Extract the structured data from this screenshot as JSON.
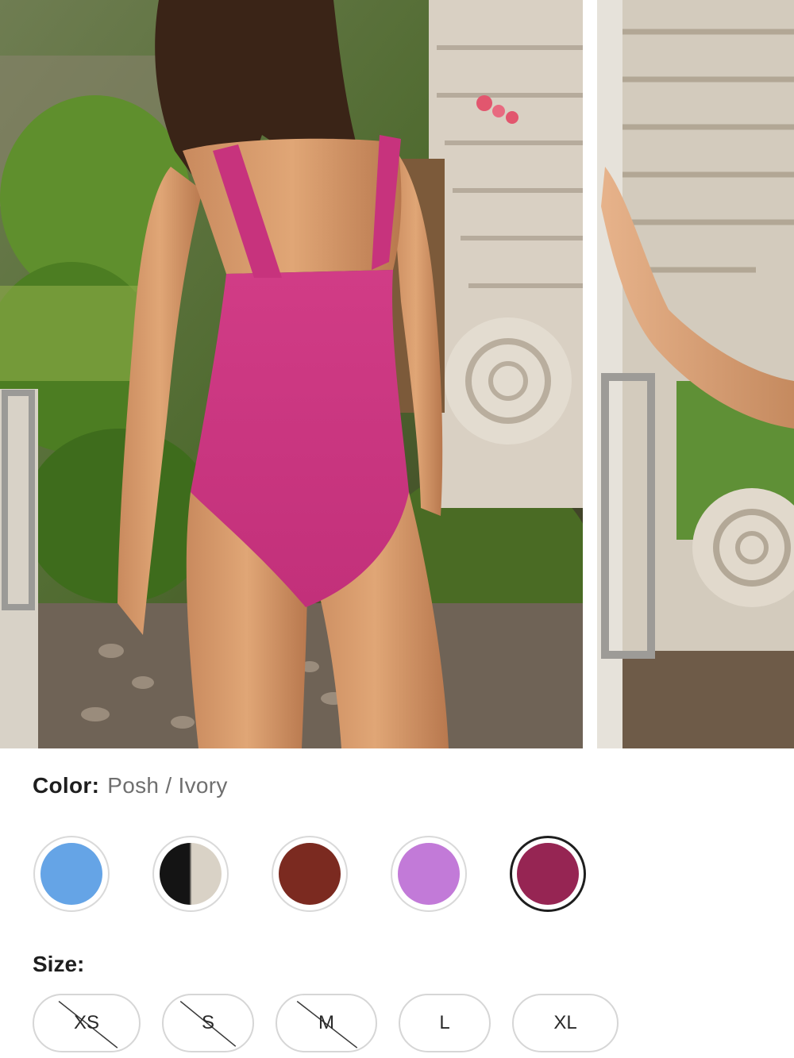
{
  "product_options": {
    "color_label": "Color:",
    "color_value": "Posh / Ivory",
    "swatches": [
      {
        "name": "light blue",
        "color": "#65a4e6"
      },
      {
        "name": "black / ivory",
        "color": "#141414",
        "color2": "#d9d2c6"
      },
      {
        "name": "brick red",
        "color": "#7b2a20"
      },
      {
        "name": "orchid",
        "color": "#c27ad8"
      },
      {
        "name": "posh",
        "color": "#962553",
        "selected": true
      }
    ],
    "size_label": "Size:",
    "sizes": [
      {
        "label": "XS",
        "available": false
      },
      {
        "label": "S",
        "available": false
      },
      {
        "label": "M",
        "available": false
      },
      {
        "label": "L",
        "available": true
      },
      {
        "label": "XL",
        "available": true
      }
    ]
  }
}
